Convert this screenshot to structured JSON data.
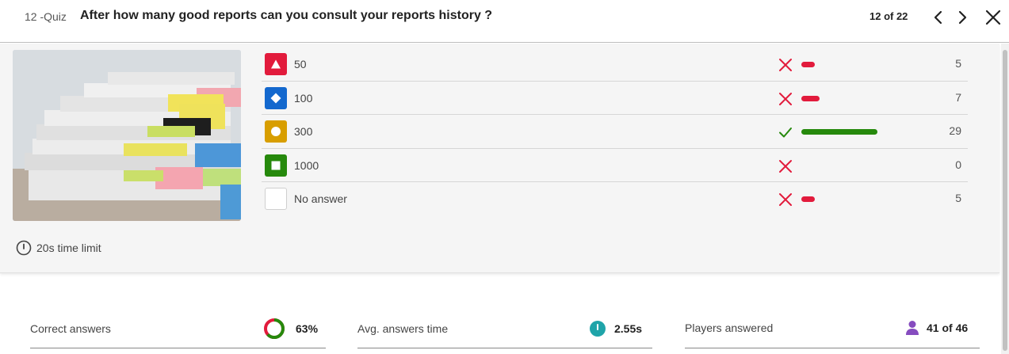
{
  "header": {
    "question_number": "12 -Quiz",
    "question_title": "After how many good reports can you consult your reports history ?",
    "pager": "12 of 22",
    "prev_icon": "chevron-left-icon",
    "next_icon": "chevron-right-icon",
    "close_icon": "close-icon"
  },
  "question": {
    "image_icon": "stacked-documents-image",
    "time_limit": "20s time limit"
  },
  "answers": [
    {
      "shape": "triangle",
      "color": "#e21b3c",
      "label": "50",
      "correct": false,
      "count": "5",
      "fraction": 0.1724
    },
    {
      "shape": "diamond",
      "color": "#1368ce",
      "label": "100",
      "correct": false,
      "count": "7",
      "fraction": 0.2414
    },
    {
      "shape": "circle",
      "color": "#d89e00",
      "label": "300",
      "correct": true,
      "count": "29",
      "fraction": 1.0
    },
    {
      "shape": "square",
      "color": "#26890c",
      "label": "1000",
      "correct": false,
      "count": "0",
      "fraction": 0
    },
    {
      "shape": "none",
      "color": "#ffffff",
      "label": "No answer",
      "correct": false,
      "count": "5",
      "fraction": 0.1724
    }
  ],
  "colors": {
    "incorrect": "#e21b3c",
    "correct": "#26890c",
    "avg_time": "#1fa4a9",
    "players": "#864cbf"
  },
  "stats": {
    "correct_label": "Correct answers",
    "correct_value": "63%",
    "correct_fraction": 0.63,
    "avg_label": "Avg. answers time",
    "avg_value": "2.55s",
    "players_label": "Players answered",
    "players_value": "41 of 46"
  }
}
